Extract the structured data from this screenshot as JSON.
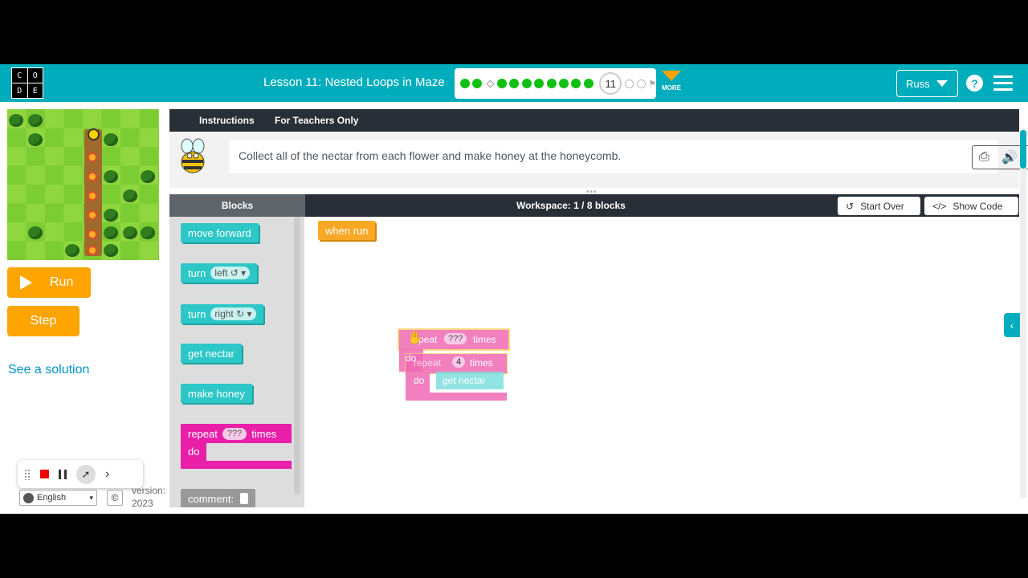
{
  "header": {
    "logo_letters": [
      "C",
      "O",
      "D",
      "E"
    ],
    "lesson_title": "Lesson 11: Nested Loops in Maze",
    "current_level": "11",
    "more_label": "MORE",
    "user_name": "Russ",
    "help_icon": "?",
    "completed_levels": 10
  },
  "left_panel": {
    "run_label": "Run",
    "step_label": "Step",
    "solution_link": "See a solution",
    "language": "English",
    "copyright_icon": "©",
    "version_label": "version:",
    "version_year": "2023"
  },
  "instructions": {
    "tab_instructions": "Instructions",
    "tab_teachers": "For Teachers Only",
    "text": "Collect all of the nectar from each flower and make honey at the honeycomb."
  },
  "workspace": {
    "blocks_title": "Blocks",
    "workspace_title": "Workspace: 1 / 8 blocks",
    "start_over": "Start Over",
    "show_code": "Show Code"
  },
  "toolbox": {
    "move_forward": "move forward",
    "turn_left": "turn",
    "turn_left_dir": "left ↺",
    "turn_right": "turn",
    "turn_right_dir": "right ↻",
    "get_nectar": "get nectar",
    "make_honey": "make honey",
    "repeat_label": "repeat",
    "repeat_value": "???",
    "repeat_times": "times",
    "do_label": "do",
    "comment_label": "comment:"
  },
  "canvas": {
    "when_run": "when run",
    "outer_repeat_value": "???",
    "outer_times": "times",
    "outer_do": "do",
    "inner_repeat": "repeat",
    "inner_repeat_value": "4",
    "inner_times": "times",
    "inner_do": "do",
    "inner_action": "get nectar",
    "outer_repeat_partial": "peat"
  },
  "colors": {
    "header_teal": "#00adbc",
    "run_orange": "#ffa400",
    "action_teal": "#2cc7c6",
    "loop_pink": "#e91fa8",
    "event_orange": "#f9a825"
  }
}
